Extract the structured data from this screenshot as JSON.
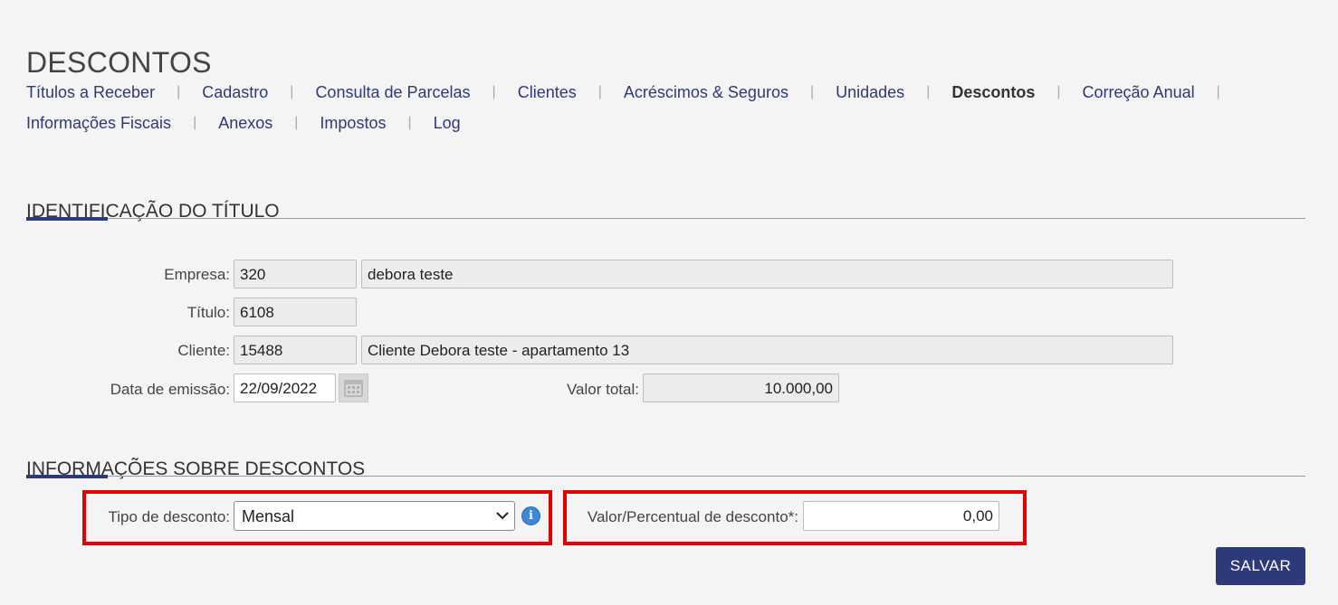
{
  "page": {
    "title": "DESCONTOS"
  },
  "tabs": {
    "row1": [
      "Títulos a Receber",
      "Cadastro",
      "Consulta de Parcelas",
      "Clientes",
      "Acréscimos & Seguros",
      "Unidades",
      "Descontos",
      "Correção Anual"
    ],
    "row2": [
      "Informações Fiscais",
      "Anexos",
      "Impostos",
      "Log"
    ],
    "separator": "|",
    "active": "Descontos"
  },
  "identificacao": {
    "title": "IDENTIFICAÇÃO DO TÍTULO",
    "empresa_label": "Empresa:",
    "empresa_code": "320",
    "empresa_name": "debora teste",
    "titulo_label": "Título:",
    "titulo_value": "6108",
    "cliente_label": "Cliente:",
    "cliente_code": "15488",
    "cliente_name": "Cliente Debora teste - apartamento 13",
    "data_label": "Data de emissão:",
    "data_value": "22/09/2022",
    "valor_label": "Valor total:",
    "valor_value": "10.000,00"
  },
  "descontos": {
    "title": "INFORMAÇÕES SOBRE DESCONTOS",
    "tipo_label": "Tipo de desconto:",
    "tipo_value": "Mensal",
    "valor_label": "Valor/Percentual de desconto*:",
    "valor_value": "0,00",
    "info_icon_glyph": "i"
  },
  "actions": {
    "save_label": "SALVAR"
  },
  "colors": {
    "accent": "#2d3a7a",
    "highlight": "#e30000",
    "info": "#3e87d6"
  },
  "icons": {
    "calendar": "calendar-icon",
    "chevron": "chevron-down-icon",
    "info": "info-icon"
  }
}
